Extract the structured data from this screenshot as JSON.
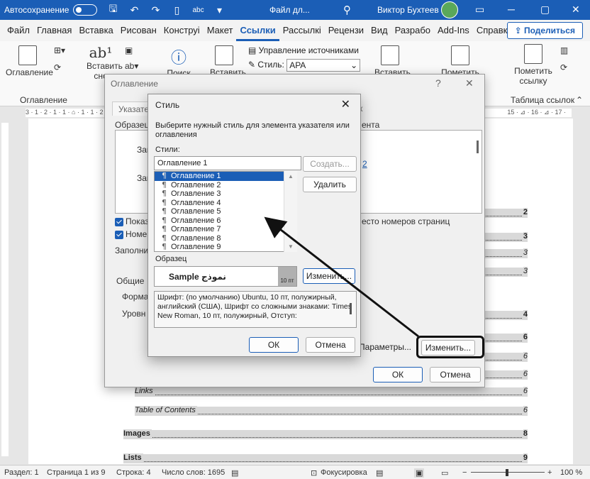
{
  "titlebar": {
    "autosave_label": "Автосохранение",
    "file_name": "Файл дл...",
    "user_name": "Виктор Бухтеев",
    "controls": [
      "─",
      "▢",
      "✕"
    ]
  },
  "ribbon": {
    "tabs": [
      "Файл",
      "Главная",
      "Вставка",
      "Рисован",
      "Конструі",
      "Макет",
      "Ссылки",
      "Рассылкі",
      "Рецензи",
      "Вид",
      "Разрабо",
      "Add-Ins",
      "Справка"
    ],
    "active_tab": "Ссылки",
    "share_label": "Поделиться",
    "toc_button": "Оглавление",
    "toc_group": "Оглавление",
    "footnote_label_1": "Вставить",
    "footnote_label_2": "сно",
    "search_label": "Поиск",
    "insert_citation_label": "Вставить",
    "manage_sources": "Управление источниками",
    "style_label": "Стиль:",
    "style_value": "APA",
    "insert_caption_label": "Вставить",
    "mark_entry_label": "Пометить",
    "mark_citation_label_1": "Пометить",
    "mark_citation_label_2": "ссылку",
    "table_of_authorities_group": "Таблица ссылок"
  },
  "ruler": {
    "left_marks": "3 · 1 · 2 · 1 · 1 · ⌂ · 1 · 1 · 2 · 1 · 3 · 1 · 4 ·",
    "right_marks": "15 · ⊿ · 16 · ⊿ · 17 ·"
  },
  "document": {
    "toc_lines": [
      {
        "text": "",
        "page": "2",
        "style": "bold"
      },
      {
        "text": "",
        "page": "3",
        "style": "bold"
      },
      {
        "text": "",
        "page": "3",
        "style": "sub"
      },
      {
        "text": "",
        "page": "3",
        "style": "sub"
      },
      {
        "text": "",
        "page": "4",
        "style": "bold"
      },
      {
        "text": "",
        "page": "6",
        "style": "bold"
      },
      {
        "text": "",
        "page": "6",
        "style": "sub"
      },
      {
        "text": "",
        "page": "6",
        "style": "sub"
      },
      {
        "text": "Links",
        "page": "6",
        "style": "sub"
      },
      {
        "text": "Table of Contents",
        "page": "6",
        "style": "sub"
      },
      {
        "text": "Images",
        "page": "8",
        "style": "bold"
      },
      {
        "text": "Lists",
        "page": "9",
        "style": "bold"
      }
    ]
  },
  "toc_dialog": {
    "title": "Оглавление",
    "tab_label": "Указате",
    "tab_label_right": "к",
    "sample_label": "Образец",
    "preview_row_1": "Заг",
    "preview_row_2": "Заг",
    "preview_link": "2",
    "preview_right_text": "ента",
    "show_page_numbers": "Показ",
    "right_align_numbers": "Номер",
    "hyperlinks_text": "есто номеров страниц",
    "fill_label": "Заполнит",
    "general_label": "Общие",
    "formats_label": "Формат",
    "levels_label": "Уровн",
    "options_button": "Параметры...",
    "modify_button": "Изменить...",
    "ok_button": "ОК",
    "cancel_button": "Отмена",
    "help_glyph": "?",
    "close_glyph": "✕"
  },
  "style_dialog": {
    "title": "Стиль",
    "description": "Выберите нужный стиль для элемента указателя или оглавления",
    "styles_label": "Стили:",
    "style_name_value": "Оглавление 1",
    "items": [
      "Оглавление 1",
      "Оглавление 2",
      "Оглавление 3",
      "Оглавление 4",
      "Оглавление 5",
      "Оглавление 6",
      "Оглавление 7",
      "Оглавление 8",
      "Оглавление 9"
    ],
    "selected_index": 0,
    "create_button": "Создать...",
    "delete_button": "Удалить",
    "sample_label": "Образец",
    "sample_text": "Sample نموذج",
    "sample_size": "10 пт",
    "modify_button": "Изменить...",
    "info_text": "Шрифт: (по умолчанию) Ubuntu, 10 пт, полужирный, английский (США), Шрифт со сложными знаками: Times New Roman, 10 пт, полужирный, Отступ:",
    "ok_button": "ОК",
    "cancel_button": "Отмена",
    "close_glyph": "✕"
  },
  "statusbar": {
    "section": "Раздел: 1",
    "page": "Страница 1 из 9",
    "line": "Строка: 4",
    "words": "Число слов: 1695",
    "focus": "Фокусировка",
    "zoom": "100 %",
    "zoom_minus": "−",
    "zoom_plus": "+"
  },
  "colors": {
    "accent": "#1b5eb6",
    "highlight_box": "#111111",
    "toc_field_shading": "#d9d9d9"
  }
}
